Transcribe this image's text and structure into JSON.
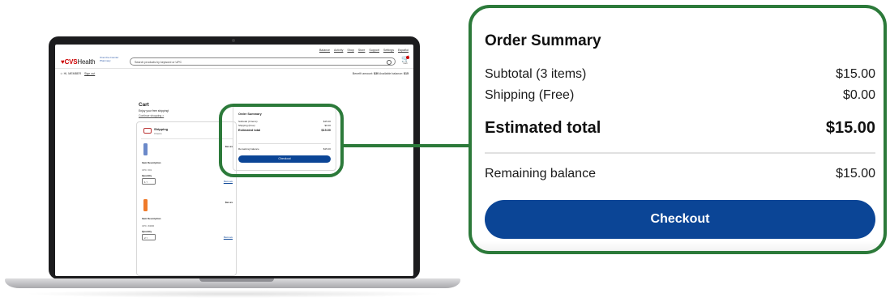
{
  "site": {
    "nav_links": [
      "Balance",
      "Activity",
      "Shop",
      "Store",
      "Support",
      "Settings",
      "Español"
    ],
    "brand": "CVS",
    "brand_suffix": "Health",
    "brand_sub_1": "Over-the-Counter",
    "brand_sub_2": "Pharmacy",
    "search_placeholder": "Search products by keyword or UPC",
    "cart_label": "Cart",
    "user_greeting": "HI, MEMBER",
    "sign_out": "Sign out",
    "benefit_label": "Benefit amount:",
    "benefit_value": "$30",
    "available_label": "Available balance:",
    "available_value": "$15"
  },
  "cart": {
    "title": "Cart",
    "subtitle": "Enjoy your free shipping!",
    "continue_link": "Continue shopping >",
    "shipping_title": "Shipping",
    "shipping_count": "3 items",
    "items": [
      {
        "price": "$xx.xx",
        "description": "Item Description",
        "upc": "UPC: 001",
        "quantity_label": "Quantity",
        "quantity": "1",
        "remove": "Remove",
        "color": "#6b89c9"
      },
      {
        "price": "$xx.xx",
        "description": "Item Description",
        "upc": "UPC: #4000",
        "quantity_label": "Quantity",
        "quantity": "2",
        "remove": "Remove",
        "color": "#ef7a2a"
      }
    ]
  },
  "order_summary": {
    "title": "Order Summary",
    "subtotal_label": "Subtotal (3 items)",
    "subtotal_value": "$15.00",
    "shipping_label": "Shipping (Free)",
    "shipping_value": "$0.00",
    "estimated_label": "Estimated total",
    "estimated_value": "$15.00",
    "remaining_label": "Remaining balance",
    "remaining_value": "$15.00",
    "checkout_label": "Checkout"
  },
  "colors": {
    "highlight_green": "#2c7a3a",
    "checkout_blue": "#0b4596",
    "brand_red": "#cc0000"
  }
}
